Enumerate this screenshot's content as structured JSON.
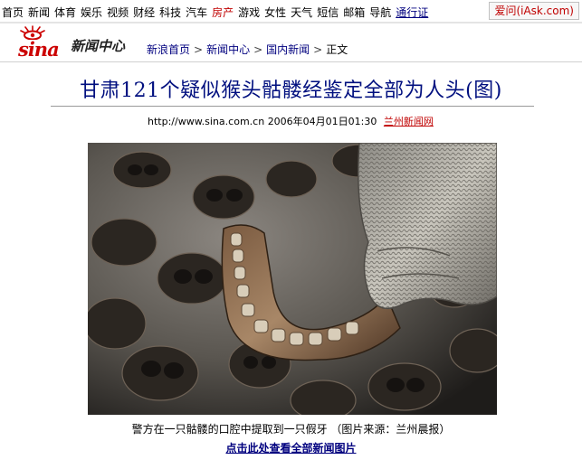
{
  "topnav": {
    "links": [
      {
        "label": "首页",
        "name": "nav-home"
      },
      {
        "label": "新闻",
        "name": "nav-news"
      },
      {
        "label": "体育",
        "name": "nav-sports"
      },
      {
        "label": "娱乐",
        "name": "nav-ent"
      },
      {
        "label": "视频",
        "name": "nav-video"
      },
      {
        "label": "财经",
        "name": "nav-finance"
      },
      {
        "label": "科技",
        "name": "nav-tech"
      },
      {
        "label": "汽车",
        "name": "nav-auto"
      },
      {
        "label": "房产",
        "name": "nav-house"
      },
      {
        "label": "游戏",
        "name": "nav-games"
      },
      {
        "label": "女性",
        "name": "nav-women"
      },
      {
        "label": "天气",
        "name": "nav-weather"
      },
      {
        "label": "短信",
        "name": "nav-sms"
      },
      {
        "label": "邮箱",
        "name": "nav-mail"
      },
      {
        "label": "导航",
        "name": "nav-guide"
      },
      {
        "label": "通行证",
        "name": "nav-passport"
      }
    ],
    "iask_label": "爱问(iAsk.com)"
  },
  "brand": {
    "logo_text": "sina",
    "section_title": "新闻中心"
  },
  "breadcrumb": {
    "items": [
      "新浪首页",
      "新闻中心",
      "国内新闻",
      "正文"
    ],
    "separator": ">"
  },
  "article": {
    "headline": "甘肃121个疑似猴头骷髅经鉴定全部为人头(图)",
    "url": "http://www.sina.com.cn",
    "datetime": "2006年04月01日01:30",
    "source": "兰州新闻网",
    "caption": "警方在一只骷髅的口腔中提取到一只假牙 （图片来源：兰州晨报）",
    "more_link": "点击此处查看全部新闻图片"
  },
  "colors": {
    "headline": "#000f7f",
    "link": "#00007f",
    "accent_red": "#c00000"
  }
}
